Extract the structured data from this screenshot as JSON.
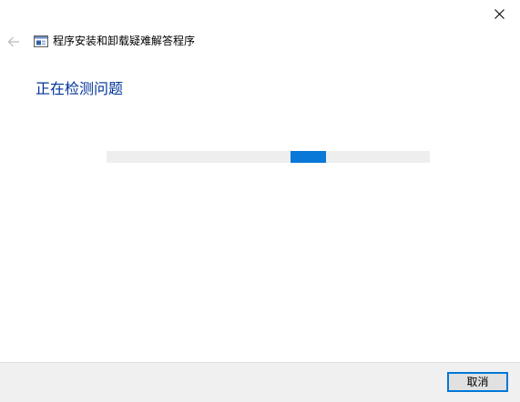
{
  "window": {
    "title": "程序安装和卸载疑难解答程序"
  },
  "icons": {
    "close": "close-icon",
    "back": "back-arrow-icon",
    "app": "troubleshooter-icon"
  },
  "main": {
    "heading": "正在检测问题",
    "progress": {
      "mode": "indeterminate",
      "accent_color": "#0A78D7",
      "track_color": "#EEEEEE"
    }
  },
  "footer": {
    "cancel_label": "取消"
  }
}
